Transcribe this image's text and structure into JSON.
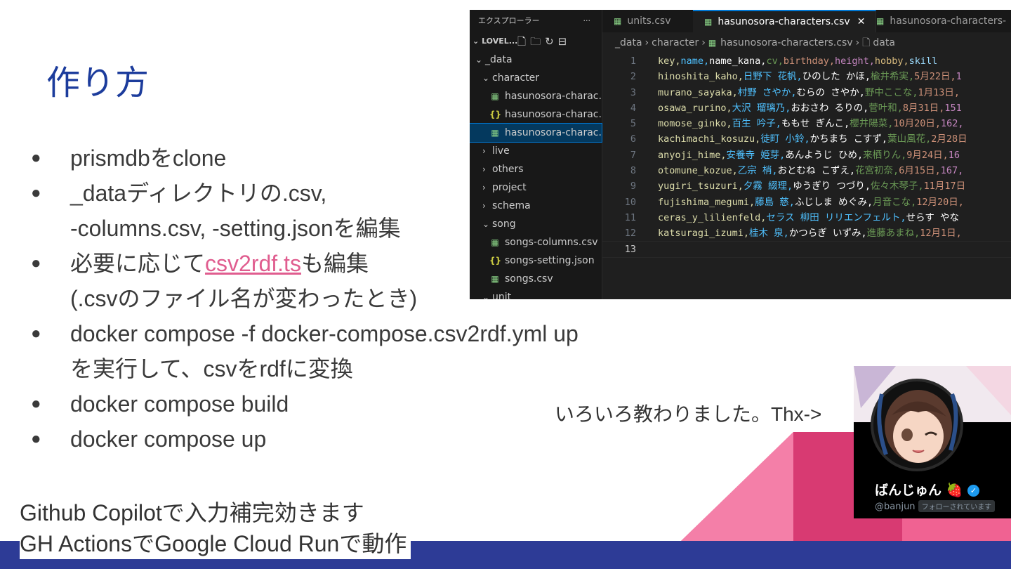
{
  "slide": {
    "title": "作り方",
    "bullets": [
      [
        "prismdbをclone"
      ],
      [
        "_dataディレクトリの.csv,",
        "-columns.csv, -setting.jsonを編集"
      ],
      [
        "必要に応じて|csv2rdf.ts|も編集",
        "(.csvのファイル名が変わったとき)"
      ],
      [
        "docker compose -f docker-compose.csv2rdf.yml up",
        "を実行して、csvをrdfに変換"
      ],
      [
        "docker compose build"
      ],
      [
        "docker compose up"
      ]
    ],
    "bullet_3_prefix": "必要に応じて",
    "bullet_3_link": "csv2rdf.ts",
    "bullet_3_suffix": "も編集",
    "thanks": "いろいろ教わりました。Thx->",
    "footnote_1": "Github Copilotで入力補完効きます",
    "footnote_2": "GH ActionsでGoogle Cloud Runで動作",
    "colors": {
      "title": "#1c3c9c",
      "footer": "#2d3b96",
      "pink": "#e05d8f",
      "pink_dark": "#d83a72"
    }
  },
  "vscode": {
    "explorer_label": "エクスプローラー",
    "explorer_menu": "···",
    "root_label": "LOVEL...",
    "tree": [
      {
        "label": "_data",
        "kind": "folder-open",
        "depth": 0
      },
      {
        "label": "character",
        "kind": "folder-open",
        "depth": 1
      },
      {
        "label": "hasunosora-charac...",
        "kind": "csv",
        "depth": 2
      },
      {
        "label": "hasunosora-charac...",
        "kind": "json",
        "depth": 2
      },
      {
        "label": "hasunosora-charac...",
        "kind": "csv",
        "depth": 2,
        "selected": true
      },
      {
        "label": "live",
        "kind": "folder",
        "depth": 1
      },
      {
        "label": "others",
        "kind": "folder",
        "depth": 1
      },
      {
        "label": "project",
        "kind": "folder",
        "depth": 1
      },
      {
        "label": "schema",
        "kind": "folder",
        "depth": 1
      },
      {
        "label": "song",
        "kind": "folder-open",
        "depth": 1
      },
      {
        "label": "songs-columns.csv",
        "kind": "csv",
        "depth": 2
      },
      {
        "label": "songs-setting.json",
        "kind": "json",
        "depth": 2
      },
      {
        "label": "songs.csv",
        "kind": "csv",
        "depth": 2
      },
      {
        "label": "unit",
        "kind": "folder-open",
        "depth": 1
      }
    ],
    "tabs": [
      {
        "label": "units.csv",
        "active": false
      },
      {
        "label": "hasunosora-characters.csv",
        "active": true
      },
      {
        "label": "hasunosora-characters-",
        "active": false
      }
    ],
    "breadcrumb": [
      "_data",
      "character",
      "hasunosora-characters.csv",
      "data"
    ],
    "code": [
      {
        "n": "1",
        "text": "key,name,name_kana,cv,birthday,height,hobby,skill"
      },
      {
        "n": "2",
        "text": "hinoshita_kaho,日野下 花帆,ひのした かほ,楡井希実,5月22日,1"
      },
      {
        "n": "3",
        "text": "murano_sayaka,村野 さやか,むらの さやか,野中ここな,1月13日,"
      },
      {
        "n": "4",
        "text": "osawa_rurino,大沢 瑠璃乃,おおさわ るりの,菅叶和,8月31日,151"
      },
      {
        "n": "5",
        "text": "momose_ginko,百生 吟子,ももせ ぎんこ,櫻井陽菜,10月20日,162,"
      },
      {
        "n": "6",
        "text": "kachimachi_kosuzu,徒町 小鈴,かちまち こすず,葉山風花,2月28日"
      },
      {
        "n": "7",
        "text": "anyoji_hime,安養寺 姫芽,あんようじ ひめ,来栖りん,9月24日,16"
      },
      {
        "n": "8",
        "text": "otomune_kozue,乙宗 梢,おとむね こずえ,花宮初奈,6月15日,167,"
      },
      {
        "n": "9",
        "text": "yugiri_tsuzuri,夕霧 綴理,ゆうぎり つづり,佐々木琴子,11月17日"
      },
      {
        "n": "10",
        "text": "fujishima_megumi,藤島 慈,ふじしま めぐみ,月音こな,12月20日,"
      },
      {
        "n": "11",
        "text": "ceras_y_lilienfeld,セラス 柳田 リリエンフェルト,せらす やな"
      },
      {
        "n": "12",
        "text": "katsuragi_izumi,桂木 泉,かつらぎ いずみ,進藤あまね,12月1日,"
      },
      {
        "n": "13",
        "text": ""
      }
    ],
    "colors": {
      "bg": "#1f1f1f",
      "sidebar": "#181818",
      "accent": "#0078d4"
    }
  },
  "card": {
    "name": "ばんじゅん",
    "handle": "@banjun",
    "follow_badge": "フォローされています",
    "emoji": "🍓"
  }
}
